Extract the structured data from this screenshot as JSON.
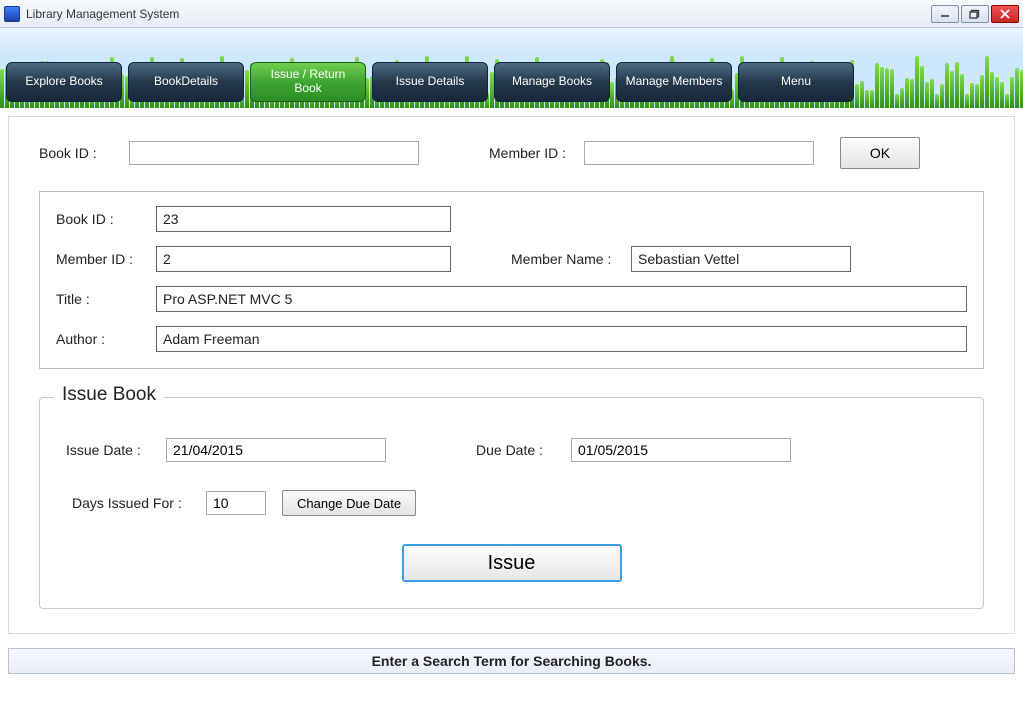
{
  "window": {
    "title": "Library Management System"
  },
  "nav": {
    "items": [
      {
        "label": "Explore Books",
        "active": false
      },
      {
        "label": "BookDetails",
        "active": false
      },
      {
        "label": "Issue / Return\nBook",
        "active": true
      },
      {
        "label": "Issue Details",
        "active": false
      },
      {
        "label": "Manage Books",
        "active": false
      },
      {
        "label": "Manage Members",
        "active": false
      },
      {
        "label": "Menu",
        "active": false
      }
    ]
  },
  "top": {
    "book_id_label": "Book ID :",
    "book_id_value": "",
    "member_id_label": "Member ID :",
    "member_id_value": "",
    "ok_label": "OK"
  },
  "details": {
    "book_id_label": "Book ID :",
    "book_id_value": "23",
    "member_id_label": "Member ID :",
    "member_id_value": "2",
    "member_name_label": "Member Name :",
    "member_name_value": "Sebastian Vettel",
    "title_label": "Title :",
    "title_value": "Pro ASP.NET MVC 5",
    "author_label": "Author :",
    "author_value": "Adam Freeman"
  },
  "issue": {
    "group_title": "Issue Book",
    "issue_date_label": "Issue Date :",
    "issue_date_value": "21/04/2015",
    "due_date_label": "Due Date :",
    "due_date_value": "01/05/2015",
    "days_label": "Days Issued For :",
    "days_value": "10",
    "change_due_label": "Change Due Date",
    "issue_button_label": "Issue"
  },
  "status": {
    "text": "Enter a Search Term for Searching Books."
  }
}
